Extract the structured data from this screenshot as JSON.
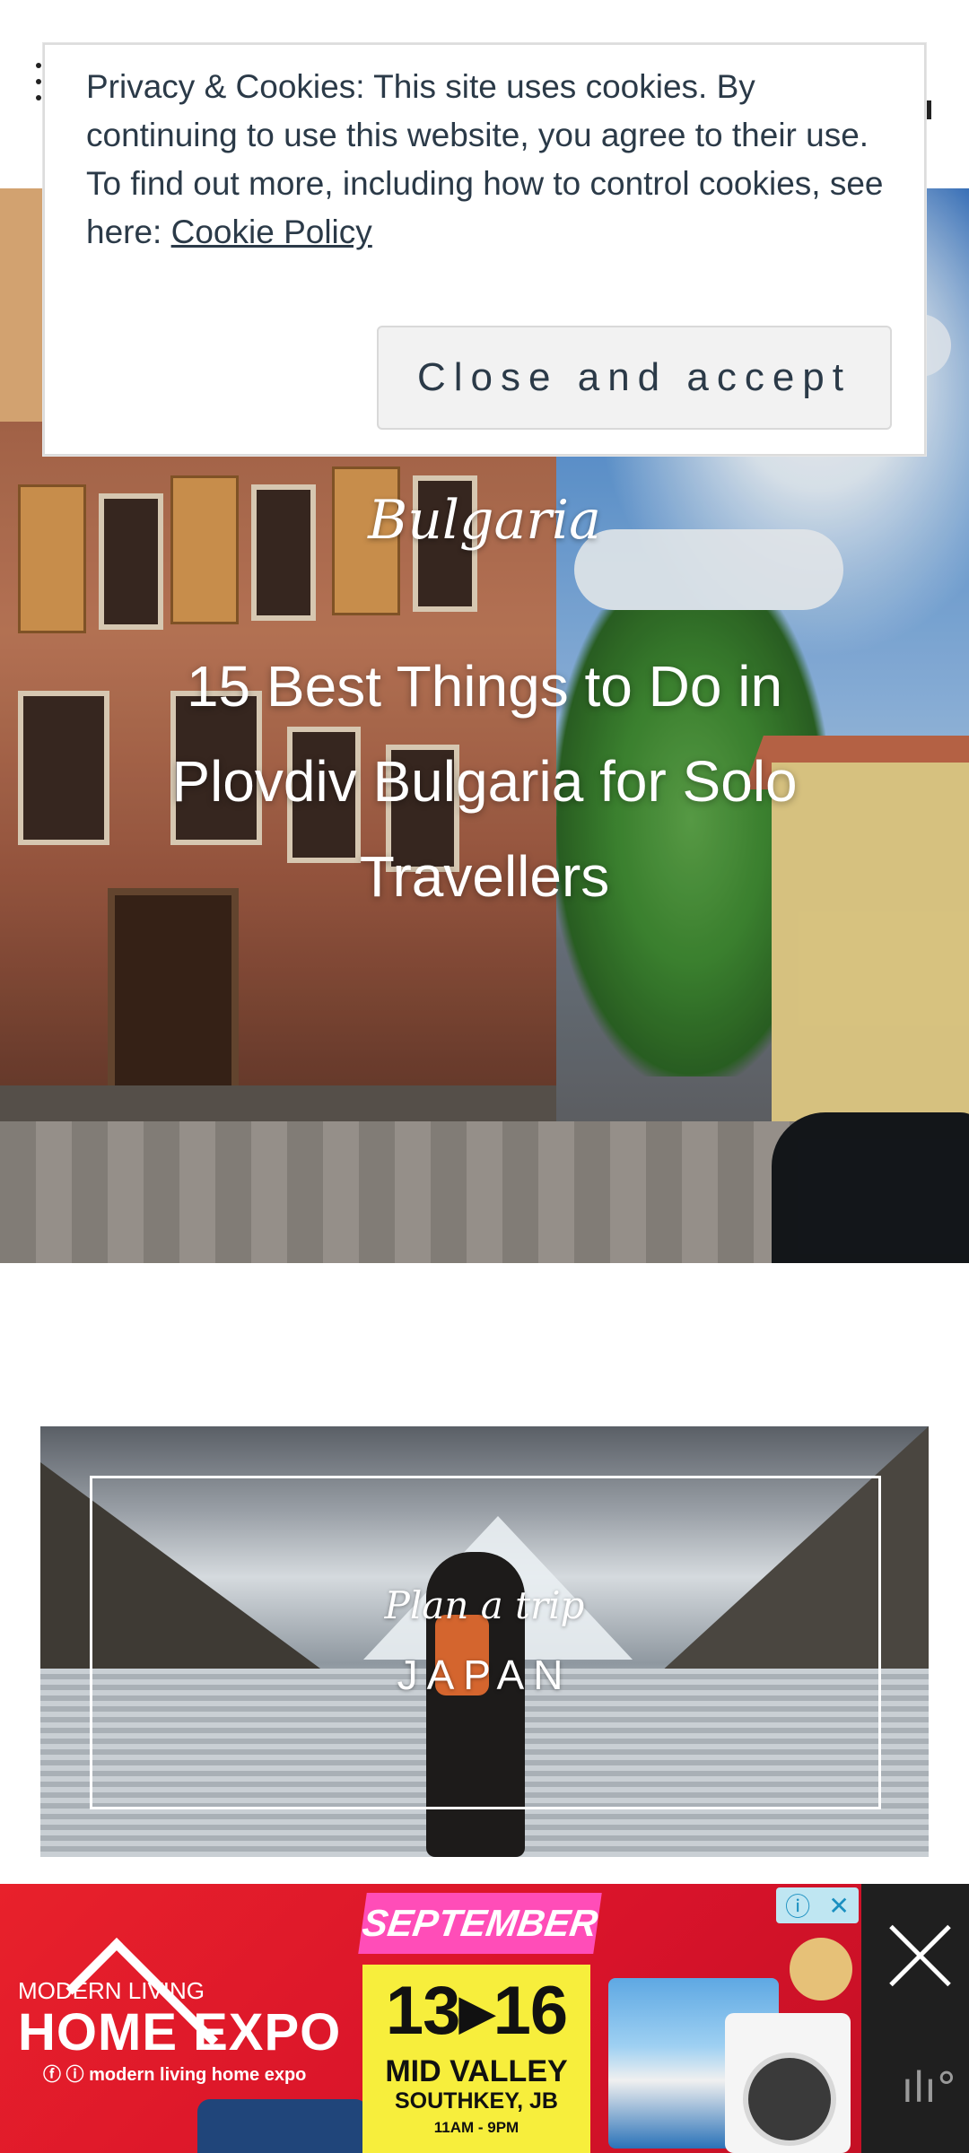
{
  "header": {
    "menu_icon": "menu-dots-icon",
    "search_icon": "search-icon"
  },
  "hero": {
    "category": "Bulgaria",
    "title": "15 Best Things to Do in Plovdiv Bulgaria for Solo Travellers"
  },
  "card": {
    "subtitle": "Plan a trip",
    "title": "JAPAN"
  },
  "cookie": {
    "text_line1": "Privacy & Cookies: This site uses cookies. By continuing to use this website, you agree to their use.",
    "text_line2": "To find out more, including how to control cookies, see here: ",
    "link": "Cookie Policy",
    "button": "Close and accept"
  },
  "ad": {
    "brand_top": "MODERN LIVING",
    "brand_main": "HOME EXPO",
    "brand_social": "modern living home expo",
    "month": "SEPTEMBER",
    "dates": "13▸16",
    "venue": "MID VALLEY",
    "city": "SOUTHKEY, JB",
    "time": "11AM - 9PM",
    "info_icon": "info-icon",
    "close_icon": "close-icon",
    "accent": "#e8212b",
    "highlight": "#f7ee3c",
    "pink": "#ff4db8"
  }
}
